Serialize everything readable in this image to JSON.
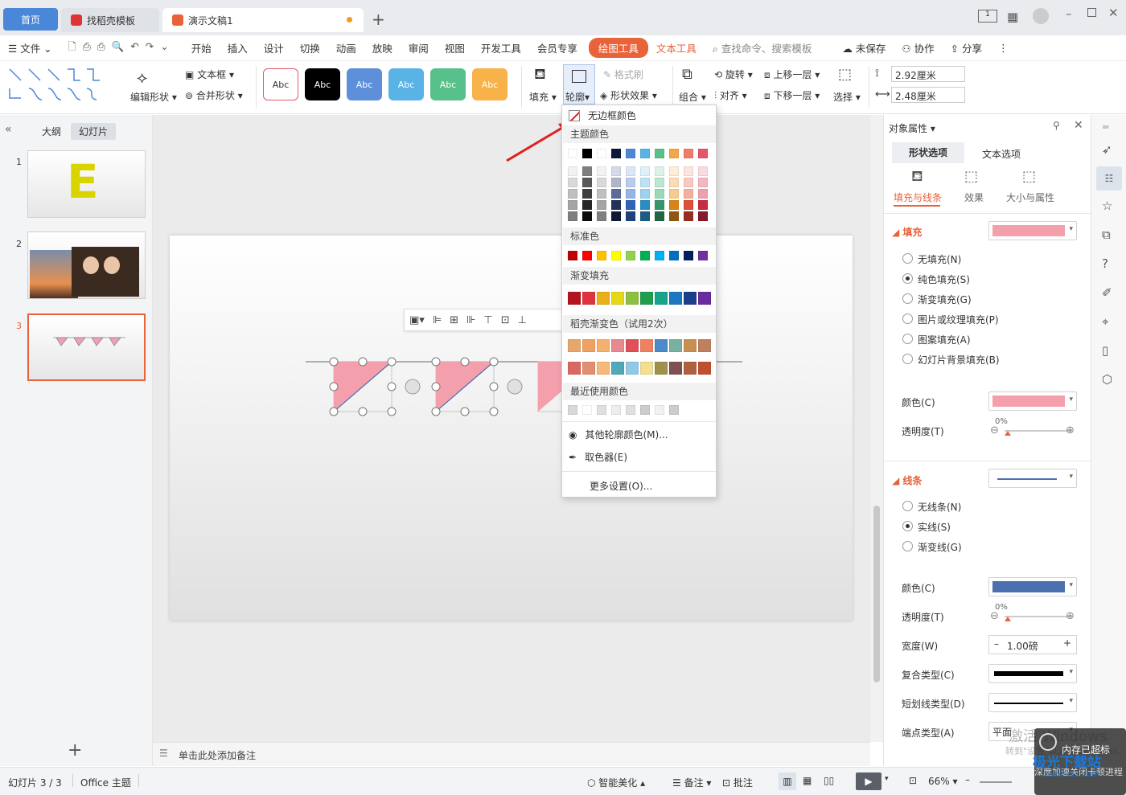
{
  "tabs": {
    "home": "首页",
    "templates": "找稻壳模板",
    "doc": "演示文稿1"
  },
  "menu": {
    "file": "文件",
    "items": [
      "开始",
      "插入",
      "设计",
      "切换",
      "动画",
      "放映",
      "审阅",
      "视图",
      "开发工具",
      "会员专享"
    ],
    "drawing_tools": "绘图工具",
    "text_tools": "文本工具",
    "search": "查找命令、搜索模板",
    "unsaved": "未保存",
    "collab": "协作",
    "share": "分享"
  },
  "ribbon": {
    "edit_shape": "编辑形状",
    "textbox": "文本框",
    "merge_shape": "合并形状",
    "styles": [
      "Abc",
      "Abc",
      "Abc",
      "Abc",
      "Abc",
      "Abc"
    ],
    "fill": "填充",
    "outline": "轮廓",
    "format_painter": "格式刷",
    "shape_effect": "形状效果",
    "group": "组合",
    "rotate": "旋转",
    "align": "对齐",
    "bring_forward": "上移一层",
    "send_backward": "下移一层",
    "select": "选择",
    "height": "2.92厘米",
    "width": "2.48厘米"
  },
  "left_panel": {
    "outline_tab": "大纲",
    "slides_tab": "幻灯片",
    "slide_numbers": [
      "1",
      "2",
      "3"
    ],
    "slide1_letter": "E",
    "add": "+"
  },
  "notes_placeholder": "单击此处添加备注",
  "popup": {
    "no_outline": "无边框颜色",
    "theme_colors": "主题颜色",
    "standard_colors": "标准色",
    "gradient_fill": "渐变填充",
    "docer_gradient": "稻壳渐变色（试用2次）",
    "recent_colors": "最近使用颜色",
    "more_outline_colors": "其他轮廓颜色(M)...",
    "eyedropper": "取色器(E)",
    "more_settings": "更多设置(O)...",
    "theme_row": [
      "#ffffff",
      "#000000",
      "#ffffff",
      "#0e1a3a",
      "#4f86d8",
      "#5ab3e6",
      "#58c08a",
      "#f3a64a",
      "#ef7d6a",
      "#e4566b"
    ],
    "theme_shades": [
      [
        "#f2f2f2",
        "#7f7f7f",
        "#f2f2f2",
        "#d6dae6",
        "#dce6f7",
        "#def0fa",
        "#ddf2e7",
        "#fdedd9",
        "#fce4df",
        "#fadbe0"
      ],
      [
        "#d9d9d9",
        "#595959",
        "#d9d9d9",
        "#aeb6cc",
        "#b9cdef",
        "#bde1f5",
        "#bce6cf",
        "#fbdbb4",
        "#f9c9bf",
        "#f4b7c1"
      ],
      [
        "#bfbfbf",
        "#3f3f3f",
        "#bfbfbf",
        "#5c6c99",
        "#95b5e8",
        "#9cd2f0",
        "#9ad9b7",
        "#f9ca8f",
        "#f5ae9f",
        "#efa0ad"
      ],
      [
        "#a5a5a5",
        "#262626",
        "#a5a5a5",
        "#243159",
        "#2d64b8",
        "#2a8cc4",
        "#35966a",
        "#d98414",
        "#df4e35",
        "#c92943"
      ],
      [
        "#7f7f7f",
        "#0c0c0c",
        "#7f7f7f",
        "#0f1932",
        "#1e437b",
        "#1c5d83",
        "#236446",
        "#90580e",
        "#952f20",
        "#86192c"
      ]
    ],
    "standard": [
      "#c00000",
      "#ff0000",
      "#ffc000",
      "#ffff00",
      "#92d050",
      "#00b050",
      "#00b0f0",
      "#0070c0",
      "#002060",
      "#7030a0"
    ],
    "gradient": [
      "#b3141e",
      "#e0343c",
      "#e8b01a",
      "#e6d718",
      "#8dc03f",
      "#1e9e4e",
      "#18a38d",
      "#1c77c3",
      "#1b3f8a",
      "#6a2aa0"
    ],
    "docer1": [
      "#e8a76a",
      "#f0a060",
      "#f5b070",
      "#e88890",
      "#e05058",
      "#f08060",
      "#4d8ac8",
      "#7ab0a0",
      "#c89050",
      "#c08060"
    ],
    "docer2": [
      "#d86860",
      "#e09070",
      "#f8b878",
      "#50a8b8",
      "#90c8e8",
      "#f0e090",
      "#a09050",
      "#805050",
      "#b06040",
      "#c05030"
    ],
    "recent": [
      "#d9d9d9",
      "#ffffff",
      "#e0e0e0",
      "#eeeeee",
      "#e0e0e0",
      "#cccccc",
      "#f2f2f2",
      "#cccccc"
    ]
  },
  "right_panel": {
    "title": "对象属性",
    "tab_shape": "形状选项",
    "tab_text": "文本选项",
    "sub_fill": "填充与线条",
    "sub_effect": "效果",
    "sub_size": "大小与属性",
    "fill_header": "填充",
    "fill_options": [
      "无填充(N)",
      "纯色填充(S)",
      "渐变填充(G)",
      "图片或纹理填充(P)",
      "图案填充(A)",
      "幻灯片背景填充(B)"
    ],
    "color_label": "颜色(C)",
    "transparency_label": "透明度(T)",
    "transparency_value": "0%",
    "line_header": "线条",
    "line_options": [
      "无线条(N)",
      "实线(S)",
      "渐变线(G)"
    ],
    "line_color_label": "颜色(C)",
    "line_transparency_label": "透明度(T)",
    "line_transparency_value": "0%",
    "width_label": "宽度(W)",
    "width_value": "1.00磅",
    "compound_label": "复合类型(C)",
    "dash_label": "短划线类型(D)",
    "cap_label": "端点类型(A)",
    "cap_value": "平面",
    "fill_color": "#f4a0ac",
    "line_color": "#4c6faf"
  },
  "status": {
    "slide_count": "幻灯片 3 / 3",
    "theme": "Office 主题",
    "beautify": "智能美化",
    "notes": "备注",
    "comments": "批注",
    "zoom": "66%"
  },
  "watermark": {
    "line1": "激活 Windows",
    "line2": "转到\"设置\"以激活 Windows。",
    "site": "极光下载站",
    "url": "www.xz7.com",
    "mem": "内存已超标",
    "mem2": "深度加速关闭卡顿进程"
  }
}
